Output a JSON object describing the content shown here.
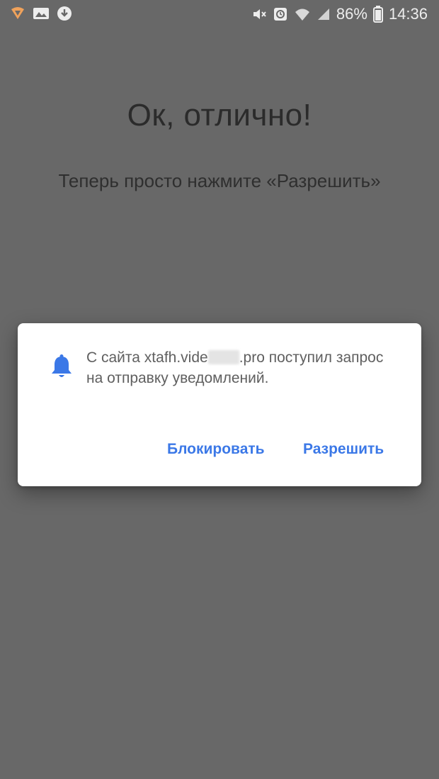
{
  "status_bar": {
    "left_icons": [
      "flame-notification-icon",
      "image-notification-icon",
      "download-notification-icon"
    ],
    "right_icons": [
      "mute-icon",
      "alarm-icon",
      "wifi-icon",
      "signal-icon"
    ],
    "battery_percent": "86%",
    "time": "14:36"
  },
  "page": {
    "headline": "Ок, отлично!",
    "subhead": "Теперь просто нажмите «Разрешить»"
  },
  "dialog": {
    "message_prefix": "С сайта xtafh.vide",
    "message_suffix": ".pro поступил запрос на отправку уведомлений.",
    "block_label": "Блокировать",
    "allow_label": "Разрешить"
  },
  "colors": {
    "background": "#686868",
    "accent": "#3b78e7",
    "dialog": "#ffffff"
  }
}
